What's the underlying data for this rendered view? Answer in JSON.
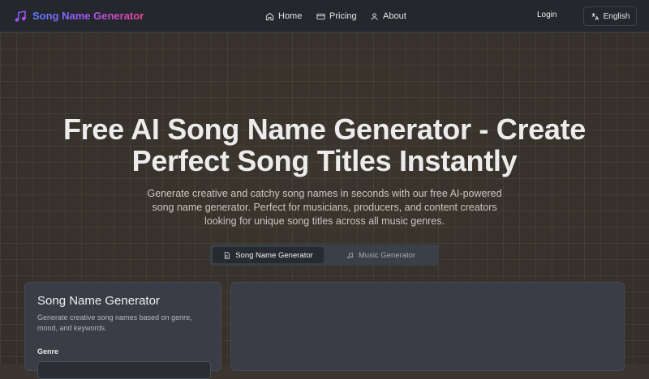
{
  "header": {
    "app_name": "Song Name Generator",
    "nav": [
      {
        "label": "Home",
        "icon": "home-icon"
      },
      {
        "label": "Pricing",
        "icon": "card-icon"
      },
      {
        "label": "About",
        "icon": "user-icon"
      }
    ],
    "login_label": "Login",
    "language_label": "English"
  },
  "hero": {
    "title_line1": "Free AI Song Name Generator - Create",
    "title_line2": "Perfect Song Titles Instantly",
    "subtitle_line1": "Generate creative and catchy song names in seconds with our free AI-powered",
    "subtitle_line2": "song name generator. Perfect for musicians, producers, and content creators",
    "subtitle_line3": "looking for unique song titles across all music genres."
  },
  "tabs": [
    {
      "label": "Song Name Generator",
      "icon": "document-icon",
      "active": true
    },
    {
      "label": "Music Generator",
      "icon": "music-note-icon",
      "active": false
    }
  ],
  "form_panel": {
    "title": "Song Name Generator",
    "description": "Generate creative song names based on genre, mood, and keywords.",
    "genre_label": "Genre"
  },
  "colors": {
    "brand_gradient": [
      "#5b7cff",
      "#a855f7",
      "#ec4899"
    ],
    "header_bg": "#24272c",
    "panel_bg": "#3a3d45"
  }
}
